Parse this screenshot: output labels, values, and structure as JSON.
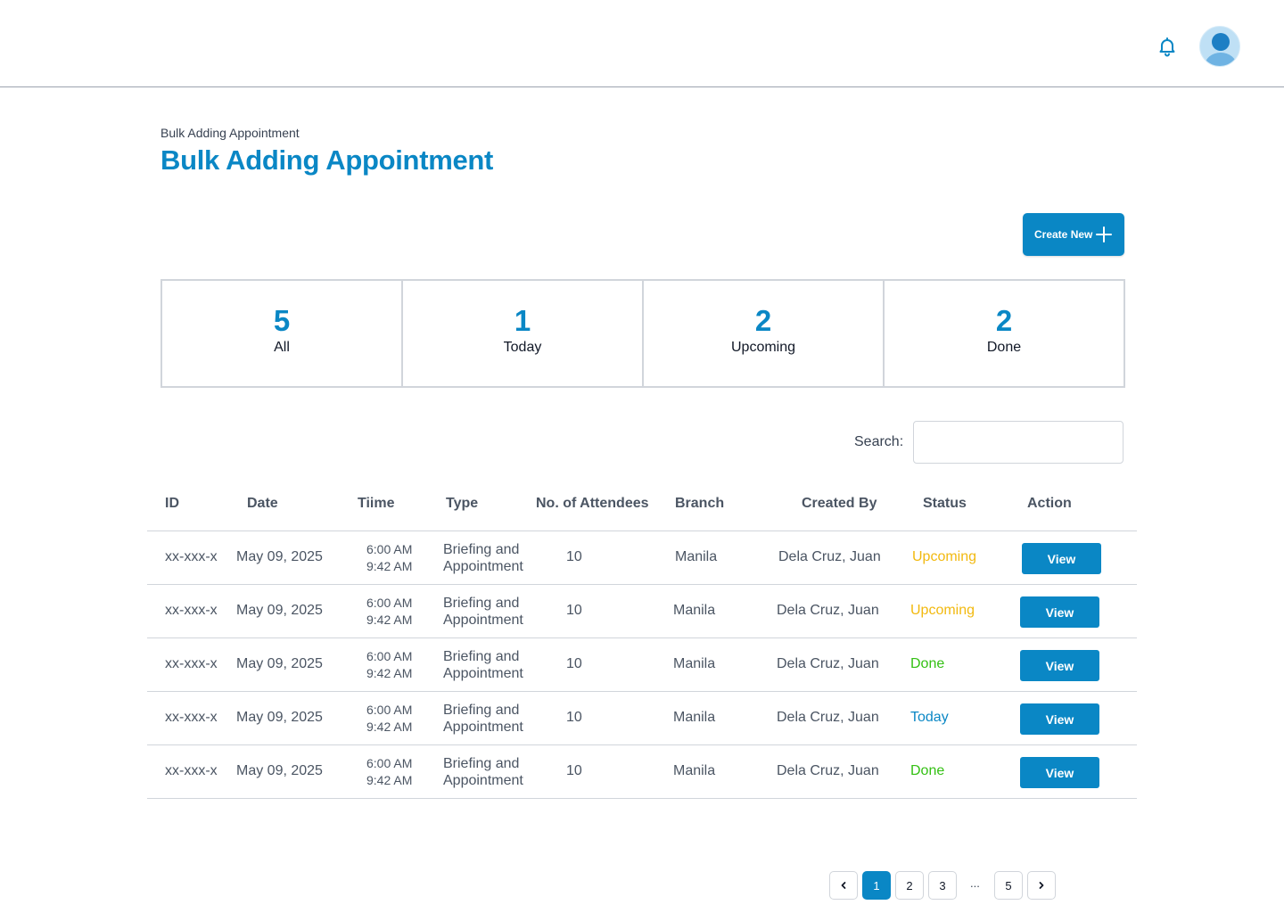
{
  "header": {
    "bell_icon": "bell-icon",
    "avatar_icon": "user-avatar-icon"
  },
  "breadcrumb": "Bulk Adding Appointment",
  "title": "Bulk Adding Appointment",
  "create_button": {
    "label": "Create New",
    "icon": "plus-icon"
  },
  "stats": [
    {
      "value": "5",
      "label": "All"
    },
    {
      "value": "1",
      "label": "Today"
    },
    {
      "value": "2",
      "label": "Upcoming"
    },
    {
      "value": "2",
      "label": "Done"
    }
  ],
  "search": {
    "label": "Search:",
    "value": "",
    "placeholder": ""
  },
  "table": {
    "headers": [
      "ID",
      "Date",
      "Tiime",
      "Type",
      "No. of Attendees",
      "Branch",
      "Created By",
      "Status",
      "Action"
    ],
    "rows": [
      {
        "id": "xx-xxx-x",
        "date": "May 09, 2025",
        "time_start": "6:00 AM",
        "time_end": "9:42 AM",
        "type_line1": "Briefing and",
        "type_line2": "Appointment",
        "attendees": "10",
        "branch": "Manila",
        "created_by": "Dela Cruz, Juan",
        "status": "Upcoming",
        "action": "View"
      },
      {
        "id": "xx-xxx-x",
        "date": "May 09, 2025",
        "time_start": "6:00 AM",
        "time_end": "9:42 AM",
        "type_line1": "Briefing and",
        "type_line2": "Appointment",
        "attendees": "10",
        "branch": "Manila",
        "created_by": "Dela Cruz, Juan",
        "status": "Upcoming",
        "action": "View"
      },
      {
        "id": "xx-xxx-x",
        "date": "May 09, 2025",
        "time_start": "6:00 AM",
        "time_end": "9:42 AM",
        "type_line1": "Briefing and",
        "type_line2": "Appointment",
        "attendees": "10",
        "branch": "Manila",
        "created_by": "Dela Cruz, Juan",
        "status": "Done",
        "action": "View"
      },
      {
        "id": "xx-xxx-x",
        "date": "May 09, 2025",
        "time_start": "6:00 AM",
        "time_end": "9:42 AM",
        "type_line1": "Briefing and",
        "type_line2": "Appointment",
        "attendees": "10",
        "branch": "Manila",
        "created_by": "Dela Cruz, Juan",
        "status": "Today",
        "action": "View"
      },
      {
        "id": "xx-xxx-x",
        "date": "May 09, 2025",
        "time_start": "6:00 AM",
        "time_end": "9:42 AM",
        "type_line1": "Briefing and",
        "type_line2": "Appointment",
        "attendees": "10",
        "branch": "Manila",
        "created_by": "Dela Cruz, Juan",
        "status": "Done",
        "action": "View"
      }
    ]
  },
  "status_colors": {
    "Upcoming": "#f2b90f",
    "Done": "#34c014",
    "Today": "#0a87c5"
  },
  "colors": {
    "accent": "#0a87c5"
  },
  "pagination": {
    "prev_icon": "chevron-left-icon",
    "next_icon": "chevron-right-icon",
    "pages": [
      "1",
      "2",
      "3",
      "5"
    ],
    "ellipsis": "...",
    "current": "1"
  }
}
